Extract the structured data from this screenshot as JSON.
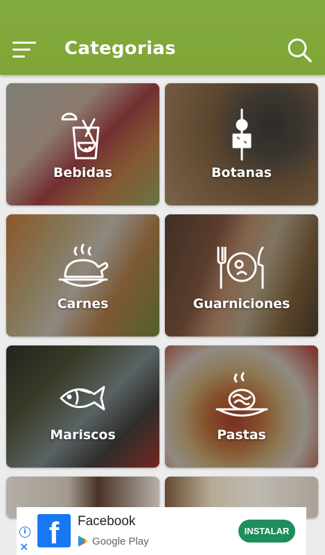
{
  "appbar": {
    "title": "Categorias"
  },
  "categories": [
    {
      "label": "Bebidas"
    },
    {
      "label": "Botanas"
    },
    {
      "label": "Carnes"
    },
    {
      "label": "Guarniciones"
    },
    {
      "label": "Mariscos"
    },
    {
      "label": "Pastas"
    }
  ],
  "ad": {
    "app_name": "Facebook",
    "store": "Google Play",
    "install_label": "INSTALAR",
    "info_icon": "info-icon",
    "close_icon": "close-icon"
  },
  "colors": {
    "appbar": "#7ea536",
    "install": "#1e8e5a",
    "facebook": "#1877f2"
  }
}
